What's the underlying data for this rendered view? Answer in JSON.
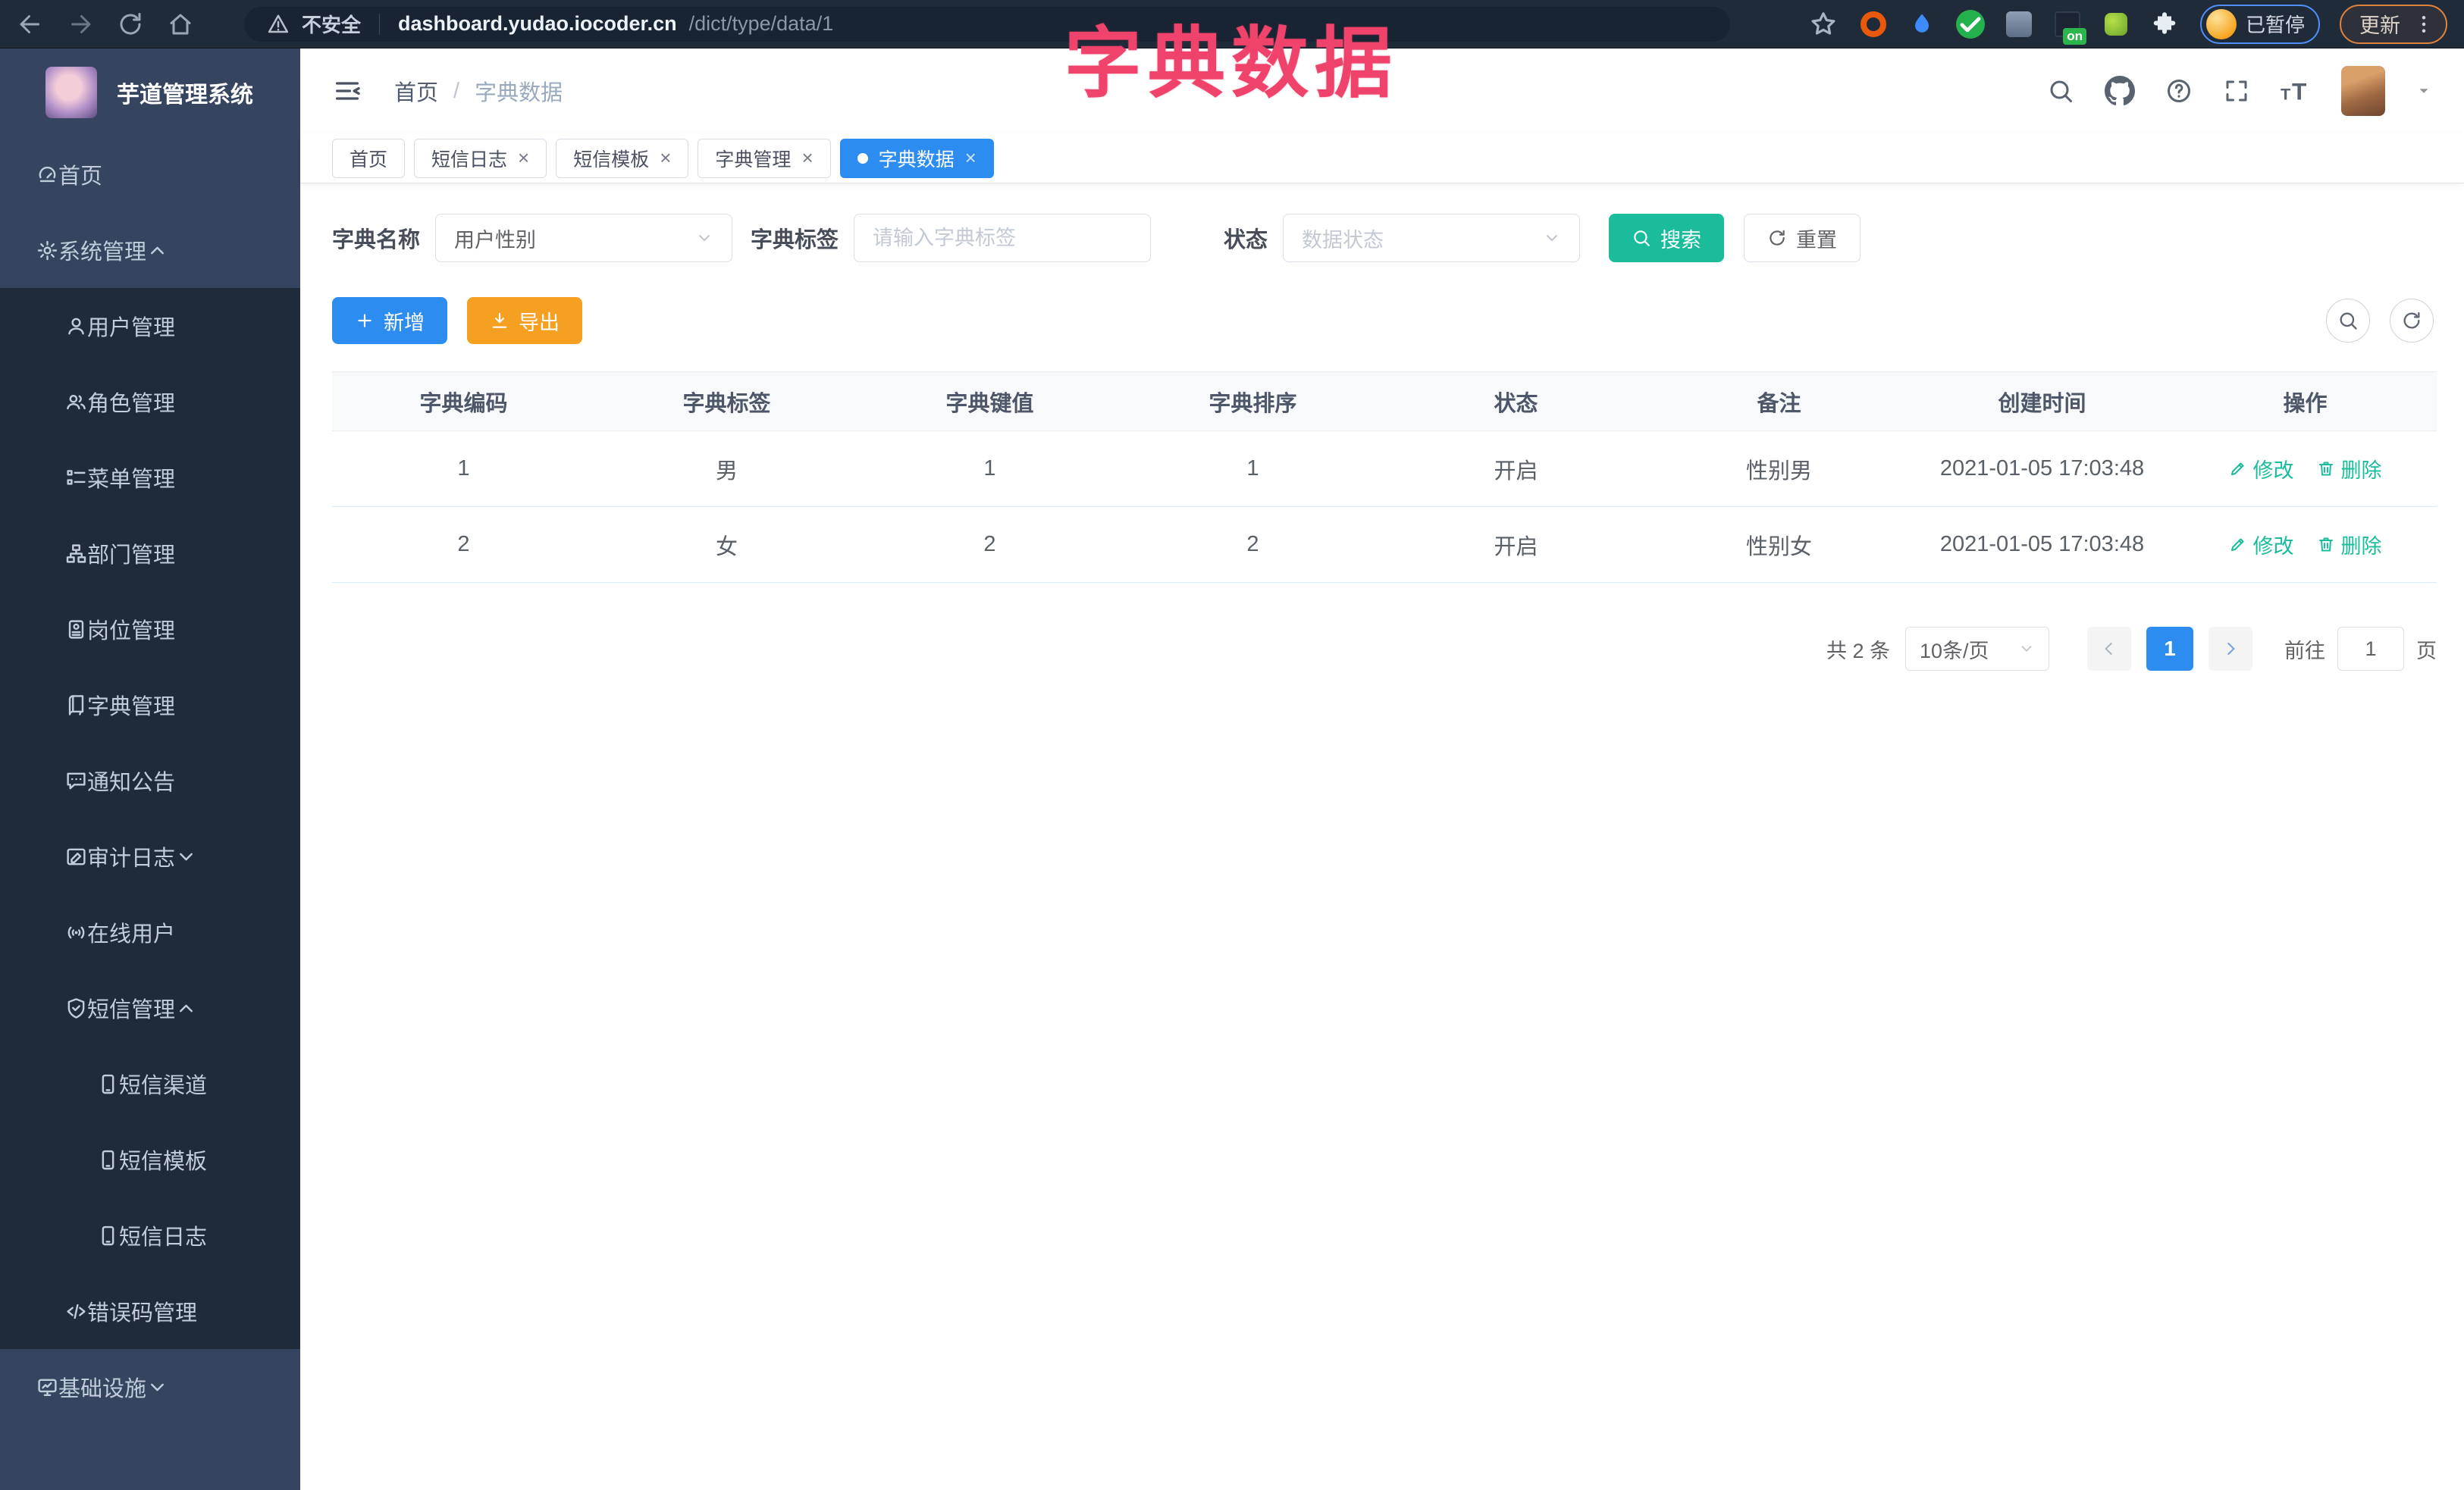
{
  "colors": {
    "chrome-bg": "#202b3a",
    "omnibox-bg": "#182433",
    "sidebar-bg": "#35445f",
    "submenu-bg": "#1f2a3a",
    "blue": "#2d8cf0",
    "teal": "#1abc9c",
    "orange": "#f5a020",
    "pink": "#f0436b"
  },
  "browser": {
    "security_label": "不安全",
    "url_host": "dashboard.yudao.iocoder.cn",
    "url_path": "/dict/type/data/1",
    "paused_label": "已暂停",
    "update_label": "更新",
    "extension_on_badge": "on",
    "extensions": [
      "orange-ring-extension-icon",
      "blue-drop-extension-icon",
      "green-check-extension-icon",
      "gray-tool-extension-icon",
      "dark-on-extension-icon",
      "green-leaf-extension-icon",
      "puzzle-extensions-icon"
    ]
  },
  "overlay": {
    "title": "字典数据"
  },
  "sidebar": {
    "app_title": "芋道管理系统",
    "menu": [
      {
        "label": "首页",
        "icon": "gauge",
        "level": 1,
        "dark": false
      },
      {
        "label": "系统管理",
        "icon": "gear",
        "level": 1,
        "dark": false,
        "arrow": "up"
      },
      {
        "label": "用户管理",
        "icon": "user",
        "level": 2,
        "dark": true
      },
      {
        "label": "角色管理",
        "icon": "users",
        "level": 2,
        "dark": true
      },
      {
        "label": "菜单管理",
        "icon": "menu-list",
        "level": 2,
        "dark": true
      },
      {
        "label": "部门管理",
        "icon": "tree",
        "level": 2,
        "dark": true
      },
      {
        "label": "岗位管理",
        "icon": "id-badge",
        "level": 2,
        "dark": true
      },
      {
        "label": "字典管理",
        "icon": "book",
        "level": 2,
        "dark": true
      },
      {
        "label": "通知公告",
        "icon": "bubble",
        "level": 2,
        "dark": true
      },
      {
        "label": "审计日志",
        "icon": "log",
        "level": 2,
        "dark": true,
        "arrow": "down"
      },
      {
        "label": "在线用户",
        "icon": "online",
        "level": 2,
        "dark": true
      },
      {
        "label": "短信管理",
        "icon": "shield",
        "level": 2,
        "dark": true,
        "arrow": "up"
      },
      {
        "label": "短信渠道",
        "icon": "phone",
        "level": 3,
        "dark": true
      },
      {
        "label": "短信模板",
        "icon": "phone",
        "level": 3,
        "dark": true
      },
      {
        "label": "短信日志",
        "icon": "phone",
        "level": 3,
        "dark": true
      },
      {
        "label": "错误码管理",
        "icon": "code",
        "level": 2,
        "dark": true
      },
      {
        "label": "基础设施",
        "icon": "monitor",
        "level": 1,
        "dark": false,
        "arrow": "down"
      }
    ]
  },
  "header": {
    "breadcrumb_home": "首页",
    "breadcrumb_sep": "/",
    "breadcrumb_current": "字典数据"
  },
  "tabs": [
    {
      "label": "首页",
      "closable": false,
      "active": false
    },
    {
      "label": "短信日志",
      "closable": true,
      "active": false
    },
    {
      "label": "短信模板",
      "closable": true,
      "active": false
    },
    {
      "label": "字典管理",
      "closable": true,
      "active": false
    },
    {
      "label": "字典数据",
      "closable": true,
      "active": true
    }
  ],
  "search": {
    "name_label": "字典名称",
    "name_value": "用户性别",
    "tag_label": "字典标签",
    "tag_placeholder": "请输入字典标签",
    "status_label": "状态",
    "status_placeholder": "数据状态",
    "search_label": "搜索",
    "reset_label": "重置"
  },
  "toolbar": {
    "add_label": "新增",
    "export_label": "导出"
  },
  "table": {
    "headers": [
      "字典编码",
      "字典标签",
      "字典键值",
      "字典排序",
      "状态",
      "备注",
      "创建时间",
      "操作"
    ],
    "rows": [
      {
        "code": "1",
        "tag": "男",
        "value": "1",
        "sort": "1",
        "status": "开启",
        "remark": "性别男",
        "created": "2021-01-05 17:03:48"
      },
      {
        "code": "2",
        "tag": "女",
        "value": "2",
        "sort": "2",
        "status": "开启",
        "remark": "性别女",
        "created": "2021-01-05 17:03:48"
      }
    ],
    "edit_label": "修改",
    "delete_label": "删除"
  },
  "pagination": {
    "total": "共 2 条",
    "page_size": "10条/页",
    "current_page": "1",
    "goto_label": "前往",
    "goto_value": "1",
    "goto_suffix": "页"
  }
}
